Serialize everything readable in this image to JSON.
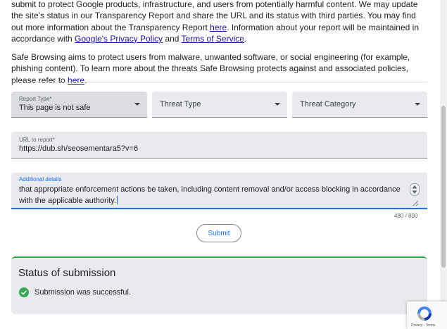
{
  "intro": {
    "p1_text1": "submit to protect Google products, infrastructure, and users from potentially harmful content. We may update the site's status in our Transparency Report and share the URL and its status with third parties. You may find out more information about the Transparency Report ",
    "p1_link_here": "here",
    "p1_text2": ". Information about your report will be maintained in accordance with ",
    "p1_link_privacy": "Google's Privacy Policy",
    "p1_text3": " and ",
    "p1_link_terms": "Terms of Service",
    "p1_text4": ".",
    "p2_text1": "Safe Browsing aims to protect users from malware, unwanted software, or social engineering (for example, phishing content). To learn more about the threats Safe Browsing protects against and associated policies, please refer to ",
    "p2_link_here": "here",
    "p2_text2": "."
  },
  "form": {
    "report_type": {
      "label": "Report Type*",
      "value": "This page is not safe"
    },
    "threat_type": {
      "placeholder": "Threat Type"
    },
    "threat_category": {
      "placeholder": "Threat Category"
    },
    "url": {
      "label": "URL to report*",
      "value": "https://dub.sh/seosementara5?v=6"
    },
    "details": {
      "label": "Additional details",
      "value": "that appropriate enforcement actions be taken, including content removal and/or access blocking in accordance with the applicable authority."
    },
    "counter": "480 / 800",
    "submit_label": "Submit"
  },
  "status": {
    "title": "Status of submission",
    "message": "Submission was successful."
  },
  "recaptcha": {
    "links": "Privacy - Terms"
  },
  "colors": {
    "accent": "#1a73e8",
    "success": "#34a853",
    "link": "#1a0dab"
  }
}
